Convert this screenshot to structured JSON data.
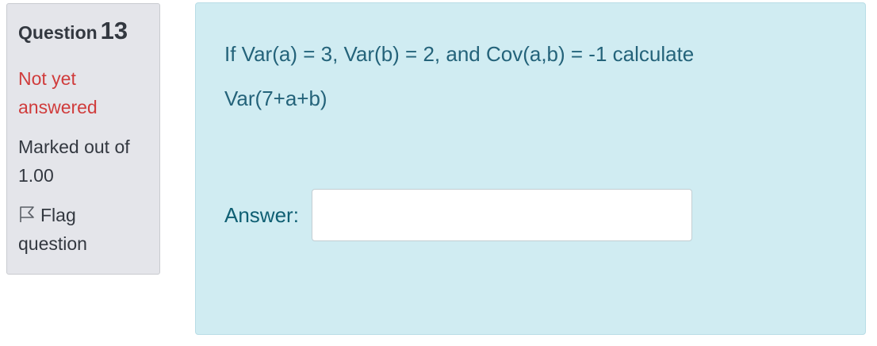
{
  "question_info": {
    "label": "Question",
    "number": "13",
    "state": "Not yet answered",
    "grade": "Marked out of 1.00",
    "flag_label": "Flag question",
    "flag_icon": "flag-outline-icon"
  },
  "question_body": {
    "text": "If Var(a) = 3, Var(b) = 2, and Cov(a,b) = -1 calculate Var(7+a+b)",
    "answer_label": "Answer:",
    "answer_value": ""
  },
  "colors": {
    "info_background": "#e4e5ea",
    "content_background": "#d0ecf2",
    "state_text": "#d03c3c",
    "question_text": "#24637a"
  }
}
